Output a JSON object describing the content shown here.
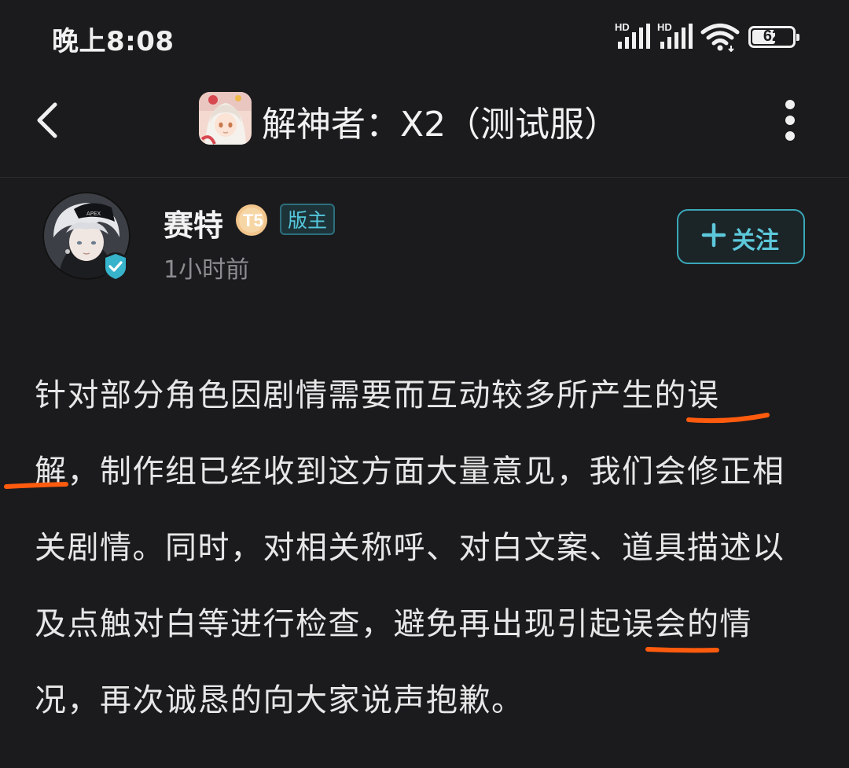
{
  "status_bar": {
    "time": "晚上8:08",
    "signal_1_label": "HD",
    "signal_2_label": "HD",
    "battery": "62",
    "battery_level": 62
  },
  "header": {
    "title": "解神者：X2（测试服）",
    "back_icon": "chevron-left-icon",
    "more_icon": "vertical-dots-icon"
  },
  "author": {
    "name": "赛特",
    "level_badge": "T5",
    "role_badge": "版主",
    "time": "1小时前",
    "follow_label": "关注"
  },
  "post": {
    "lines": [
      "针对部分角色因剧情需要而互动较多所产生的误",
      "解，制作组已经收到这方面大量意见，我们会修正相",
      "关剧情。同时，对相关称呼、对白文案、道具描述以",
      "及点触对白等进行检查，避免再出现引起误会的情",
      "况，再次诚恳的向大家说声抱歉。"
    ]
  },
  "colors": {
    "background": "#1b1b1d",
    "accent": "#5cc8da",
    "annotation": "#ff5b0e"
  }
}
